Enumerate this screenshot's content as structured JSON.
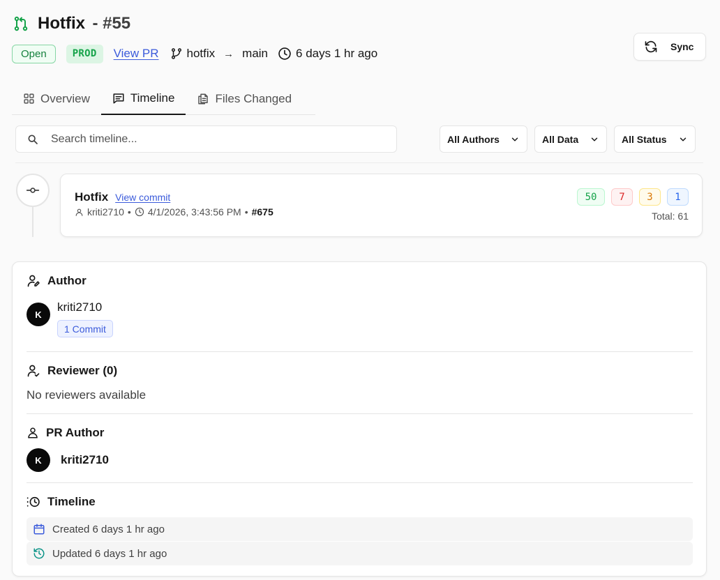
{
  "header": {
    "title": "Hotfix",
    "number": "- #55",
    "status_badge": "Open",
    "env_badge": "PROD",
    "view_pr_label": "View PR",
    "source_branch": "hotfix",
    "target_branch": "main",
    "age": "6 days 1 hr ago",
    "sync_label": "Sync"
  },
  "tabs": [
    {
      "label": "Overview",
      "icon": "grid-icon",
      "active": false
    },
    {
      "label": "Timeline",
      "icon": "message-icon",
      "active": true
    },
    {
      "label": "Files Changed",
      "icon": "files-icon",
      "active": false
    }
  ],
  "search": {
    "placeholder": "Search timeline..."
  },
  "filters": {
    "authors": "All Authors",
    "data": "All Data",
    "status": "All Status"
  },
  "commit": {
    "title": "Hotfix",
    "view_commit_label": "View commit",
    "author": "kriti2710",
    "sep1": "•",
    "datetime": "4/1/2026, 3:43:56 PM",
    "sep2": "•",
    "number": "#675",
    "stats": {
      "added": "50",
      "deleted": "7",
      "modified": "3",
      "other": "1"
    },
    "total": "Total: 61"
  },
  "details": {
    "author": {
      "heading": "Author",
      "avatar_initial": "K",
      "name": "kriti2710",
      "commit_count": "1 Commit"
    },
    "reviewer": {
      "heading": "Reviewer (0)",
      "empty_text": "No reviewers available"
    },
    "pr_author": {
      "heading": "PR Author",
      "avatar_initial": "K",
      "name": "kriti2710"
    },
    "timeline": {
      "heading": "Timeline",
      "created": "Created 6 days 1 hr ago",
      "updated": "Updated 6 days 1 hr ago"
    }
  },
  "colors": {
    "accent_green": "#16a34a",
    "link_blue": "#3b5bdb",
    "delete_red": "#dc2626",
    "modify_amber": "#d97706"
  }
}
